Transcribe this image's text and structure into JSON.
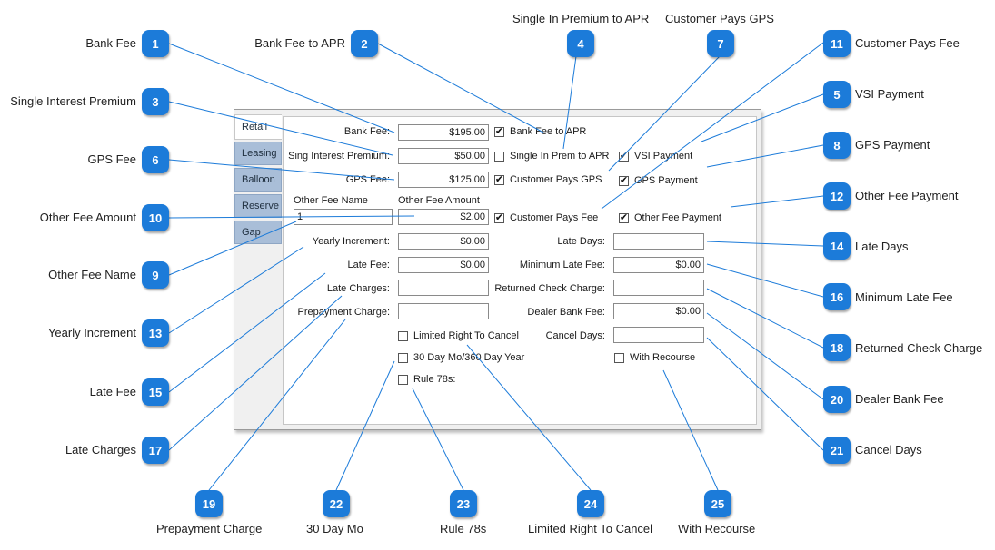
{
  "callouts": [
    {
      "num": "1",
      "label": "Bank Fee"
    },
    {
      "num": "2",
      "label": "Bank Fee to APR"
    },
    {
      "num": "3",
      "label": "Single Interest Premium"
    },
    {
      "num": "4",
      "label": "Single In Premium to APR"
    },
    {
      "num": "5",
      "label": "VSI Payment"
    },
    {
      "num": "6",
      "label": "GPS Fee"
    },
    {
      "num": "7",
      "label": "Customer Pays GPS"
    },
    {
      "num": "8",
      "label": "GPS Payment"
    },
    {
      "num": "9",
      "label": "Other Fee Name"
    },
    {
      "num": "10",
      "label": "Other Fee Amount"
    },
    {
      "num": "11",
      "label": "Customer Pays Fee"
    },
    {
      "num": "12",
      "label": "Other Fee Payment"
    },
    {
      "num": "13",
      "label": "Yearly Increment"
    },
    {
      "num": "14",
      "label": "Late Days"
    },
    {
      "num": "15",
      "label": "Late Fee"
    },
    {
      "num": "16",
      "label": "Minimum Late Fee"
    },
    {
      "num": "17",
      "label": "Late Charges"
    },
    {
      "num": "18",
      "label": "Returned Check Charge"
    },
    {
      "num": "19",
      "label": "Prepayment Charge"
    },
    {
      "num": "20",
      "label": "Dealer Bank Fee"
    },
    {
      "num": "21",
      "label": "Cancel Days"
    },
    {
      "num": "22",
      "label": "30 Day Mo"
    },
    {
      "num": "23",
      "label": "Rule 78s"
    },
    {
      "num": "24",
      "label": "Limited Right To Cancel"
    },
    {
      "num": "25",
      "label": "With Recourse"
    }
  ],
  "tabs": [
    "Retail",
    "Leasing",
    "Balloon",
    "Reserve",
    "Gap"
  ],
  "form": {
    "bank_fee_label": "Bank Fee:",
    "bank_fee_value": "$195.00",
    "sing_interest_label": "Sing Interest Premium:",
    "sing_interest_value": "$50.00",
    "gps_fee_label": "GPS Fee:",
    "gps_fee_value": "$125.00",
    "other_fee_name_header": "Other Fee Name",
    "other_fee_amount_header": "Other Fee Amount",
    "other_fee_name_value": "1",
    "other_fee_amount_value": "$2.00",
    "yearly_increment_label": "Yearly Increment:",
    "yearly_increment_value": "$0.00",
    "late_fee_label": "Late Fee:",
    "late_fee_value": "$0.00",
    "late_charges_label": "Late Charges:",
    "late_charges_value": "",
    "prepayment_charge_label": "Prepayment Charge:",
    "prepayment_charge_value": "",
    "late_days_label": "Late Days:",
    "late_days_value": "",
    "minimum_late_fee_label": "Minimum Late Fee:",
    "minimum_late_fee_value": "$0.00",
    "returned_check_label": "Returned Check Charge:",
    "returned_check_value": "",
    "dealer_bank_fee_label": "Dealer Bank Fee:",
    "dealer_bank_fee_value": "$0.00",
    "cancel_days_label": "Cancel Days:",
    "cancel_days_value": ""
  },
  "checkboxes": {
    "bank_fee_to_apr": {
      "label": "Bank Fee to APR",
      "checked": true
    },
    "single_in_prem_to_apr": {
      "label": "Single In Prem to APR",
      "checked": false
    },
    "vsi_payment": {
      "label": "VSI Payment",
      "checked": true
    },
    "customer_pays_gps": {
      "label": "Customer Pays GPS",
      "checked": true
    },
    "gps_payment": {
      "label": "GPS Payment",
      "checked": true
    },
    "customer_pays_fee": {
      "label": "Customer Pays Fee",
      "checked": true
    },
    "other_fee_payment": {
      "label": "Other Fee Payment",
      "checked": true
    },
    "limited_right_to_cancel": {
      "label": "Limited Right To Cancel",
      "checked": false
    },
    "day30_mo_360": {
      "label": "30 Day Mo/360 Day Year",
      "checked": false
    },
    "rule_78s": {
      "label": "Rule 78s:",
      "checked": false
    },
    "with_recourse": {
      "label": "With Recourse",
      "checked": false
    }
  },
  "colors": {
    "badge": "#1c7bd9",
    "leader": "#1c7bd9",
    "tab": "#a9bed8"
  },
  "icons": {
    "checkmark": "check-icon"
  }
}
